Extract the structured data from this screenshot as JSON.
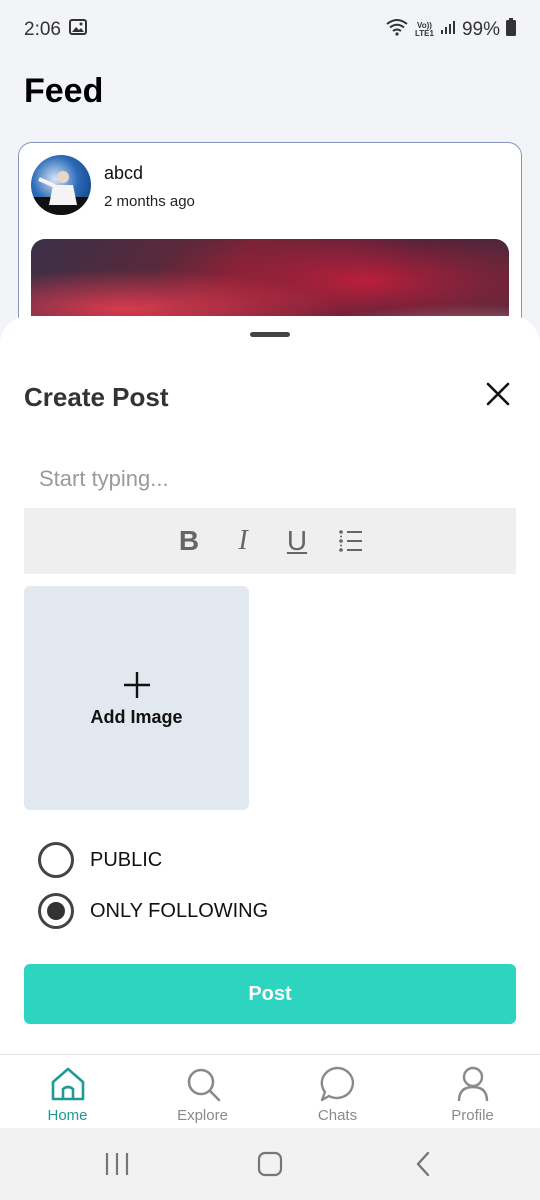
{
  "status_bar": {
    "time": "2:06",
    "lte_top": "Vo))",
    "lte_bottom": "LTE1",
    "battery": "99%"
  },
  "feed": {
    "title": "Feed",
    "post": {
      "username": "abcd",
      "time": "2 months ago"
    }
  },
  "create_post": {
    "title": "Create Post",
    "input_placeholder": "Start typing...",
    "toolbar": {
      "bold": "B",
      "italic": "I",
      "underline": "U"
    },
    "add_image_plus": "+",
    "add_image_label": "Add Image",
    "visibility": {
      "options": [
        "PUBLIC",
        "ONLY FOLLOWING"
      ],
      "selected": "ONLY FOLLOWING"
    },
    "post_button": "Post"
  },
  "bottom_nav": {
    "items": [
      {
        "label": "Home",
        "icon": "home-icon"
      },
      {
        "label": "Explore",
        "icon": "search-icon"
      },
      {
        "label": "Chats",
        "icon": "chat-icon"
      },
      {
        "label": "Profile",
        "icon": "profile-icon"
      }
    ],
    "active": "Home"
  },
  "colors": {
    "accent": "#2dd4bf",
    "nav_active": "#1e9a95",
    "image_placeholder_bg": "#e1e8f0"
  }
}
